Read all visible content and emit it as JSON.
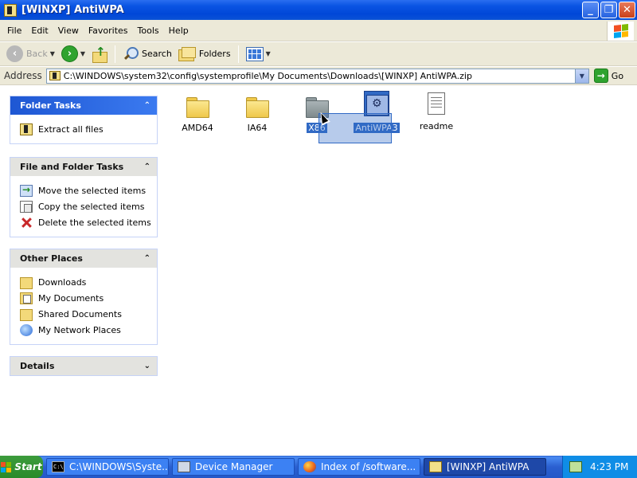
{
  "window": {
    "title": "[WINXP] AntiWPA"
  },
  "window_buttons": {
    "minimize": "_",
    "maximize": "❐",
    "close": "✕"
  },
  "menu": [
    "File",
    "Edit",
    "View",
    "Favorites",
    "Tools",
    "Help"
  ],
  "toolbar": {
    "back_label": "Back",
    "search_label": "Search",
    "folders_label": "Folders"
  },
  "address": {
    "label": "Address",
    "value": "C:\\WINDOWS\\system32\\config\\systemprofile\\My Documents\\Downloads\\[WINXP] AntiWPA.zip",
    "go_label": "Go"
  },
  "panels": {
    "folder_tasks": {
      "title": "Folder Tasks",
      "items": [
        "Extract all files"
      ]
    },
    "file_tasks": {
      "title": "File and Folder Tasks",
      "items": [
        "Move the selected items",
        "Copy the selected items",
        "Delete the selected items"
      ]
    },
    "other_places": {
      "title": "Other Places",
      "items": [
        "Downloads",
        "My Documents",
        "Shared Documents",
        "My Network Places"
      ]
    },
    "details": {
      "title": "Details"
    }
  },
  "files": [
    "AMD64",
    "IA64",
    "X86",
    "AntiWPA3",
    "readme"
  ],
  "taskbar": {
    "start_label": "Start",
    "tasks": [
      "C:\\WINDOWS\\Syste...",
      "Device Manager",
      "Index of /software...",
      "[WINXP] AntiWPA"
    ],
    "clock": "4:23 PM"
  },
  "colors": {
    "selection": "#316ac5",
    "title_bar": "#0a54e3",
    "taskbar": "#2458c8"
  }
}
